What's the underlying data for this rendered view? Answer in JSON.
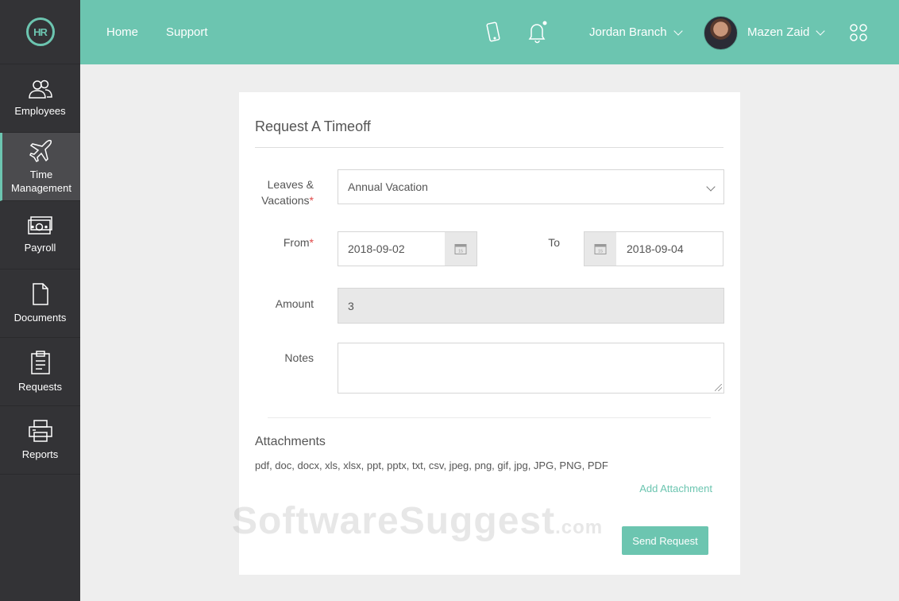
{
  "sidebar": {
    "logo_text": "HR",
    "items": [
      {
        "label": "Employees",
        "icon": "users-icon"
      },
      {
        "label": "Time Management",
        "icon": "airplane-icon",
        "active": true
      },
      {
        "label": "Payroll",
        "icon": "money-icon"
      },
      {
        "label": "Documents",
        "icon": "document-icon"
      },
      {
        "label": "Requests",
        "icon": "clipboard-icon"
      },
      {
        "label": "Reports",
        "icon": "printer-icon"
      }
    ]
  },
  "header": {
    "links": [
      "Home",
      "Support"
    ],
    "company": "Jordan Branch",
    "user": "Mazen Zaid"
  },
  "form": {
    "title": "Request A Timeoff",
    "leave_label": "Leaves & Vacations",
    "leave_value": "Annual Vacation",
    "from_label": "From",
    "from_value": "2018-09-02",
    "to_label": "To",
    "to_value": "2018-09-04",
    "amount_label": "Amount",
    "amount_value": "3",
    "notes_label": "Notes",
    "notes_value": "",
    "attachments_title": "Attachments",
    "attachment_types": "pdf, doc, docx, xls, xlsx, ppt, pptx, txt, csv, jpeg, png, gif, jpg, JPG, PNG, PDF",
    "add_attachment": "Add Attachment",
    "submit": "Send Request",
    "required_mark": "*",
    "calendar_day": "15"
  },
  "watermark": {
    "main": "SoftwareSuggest",
    "suffix": ".com"
  },
  "colors": {
    "accent": "#6cc5b0",
    "sidebar": "#333336",
    "required": "#e04a4a"
  }
}
